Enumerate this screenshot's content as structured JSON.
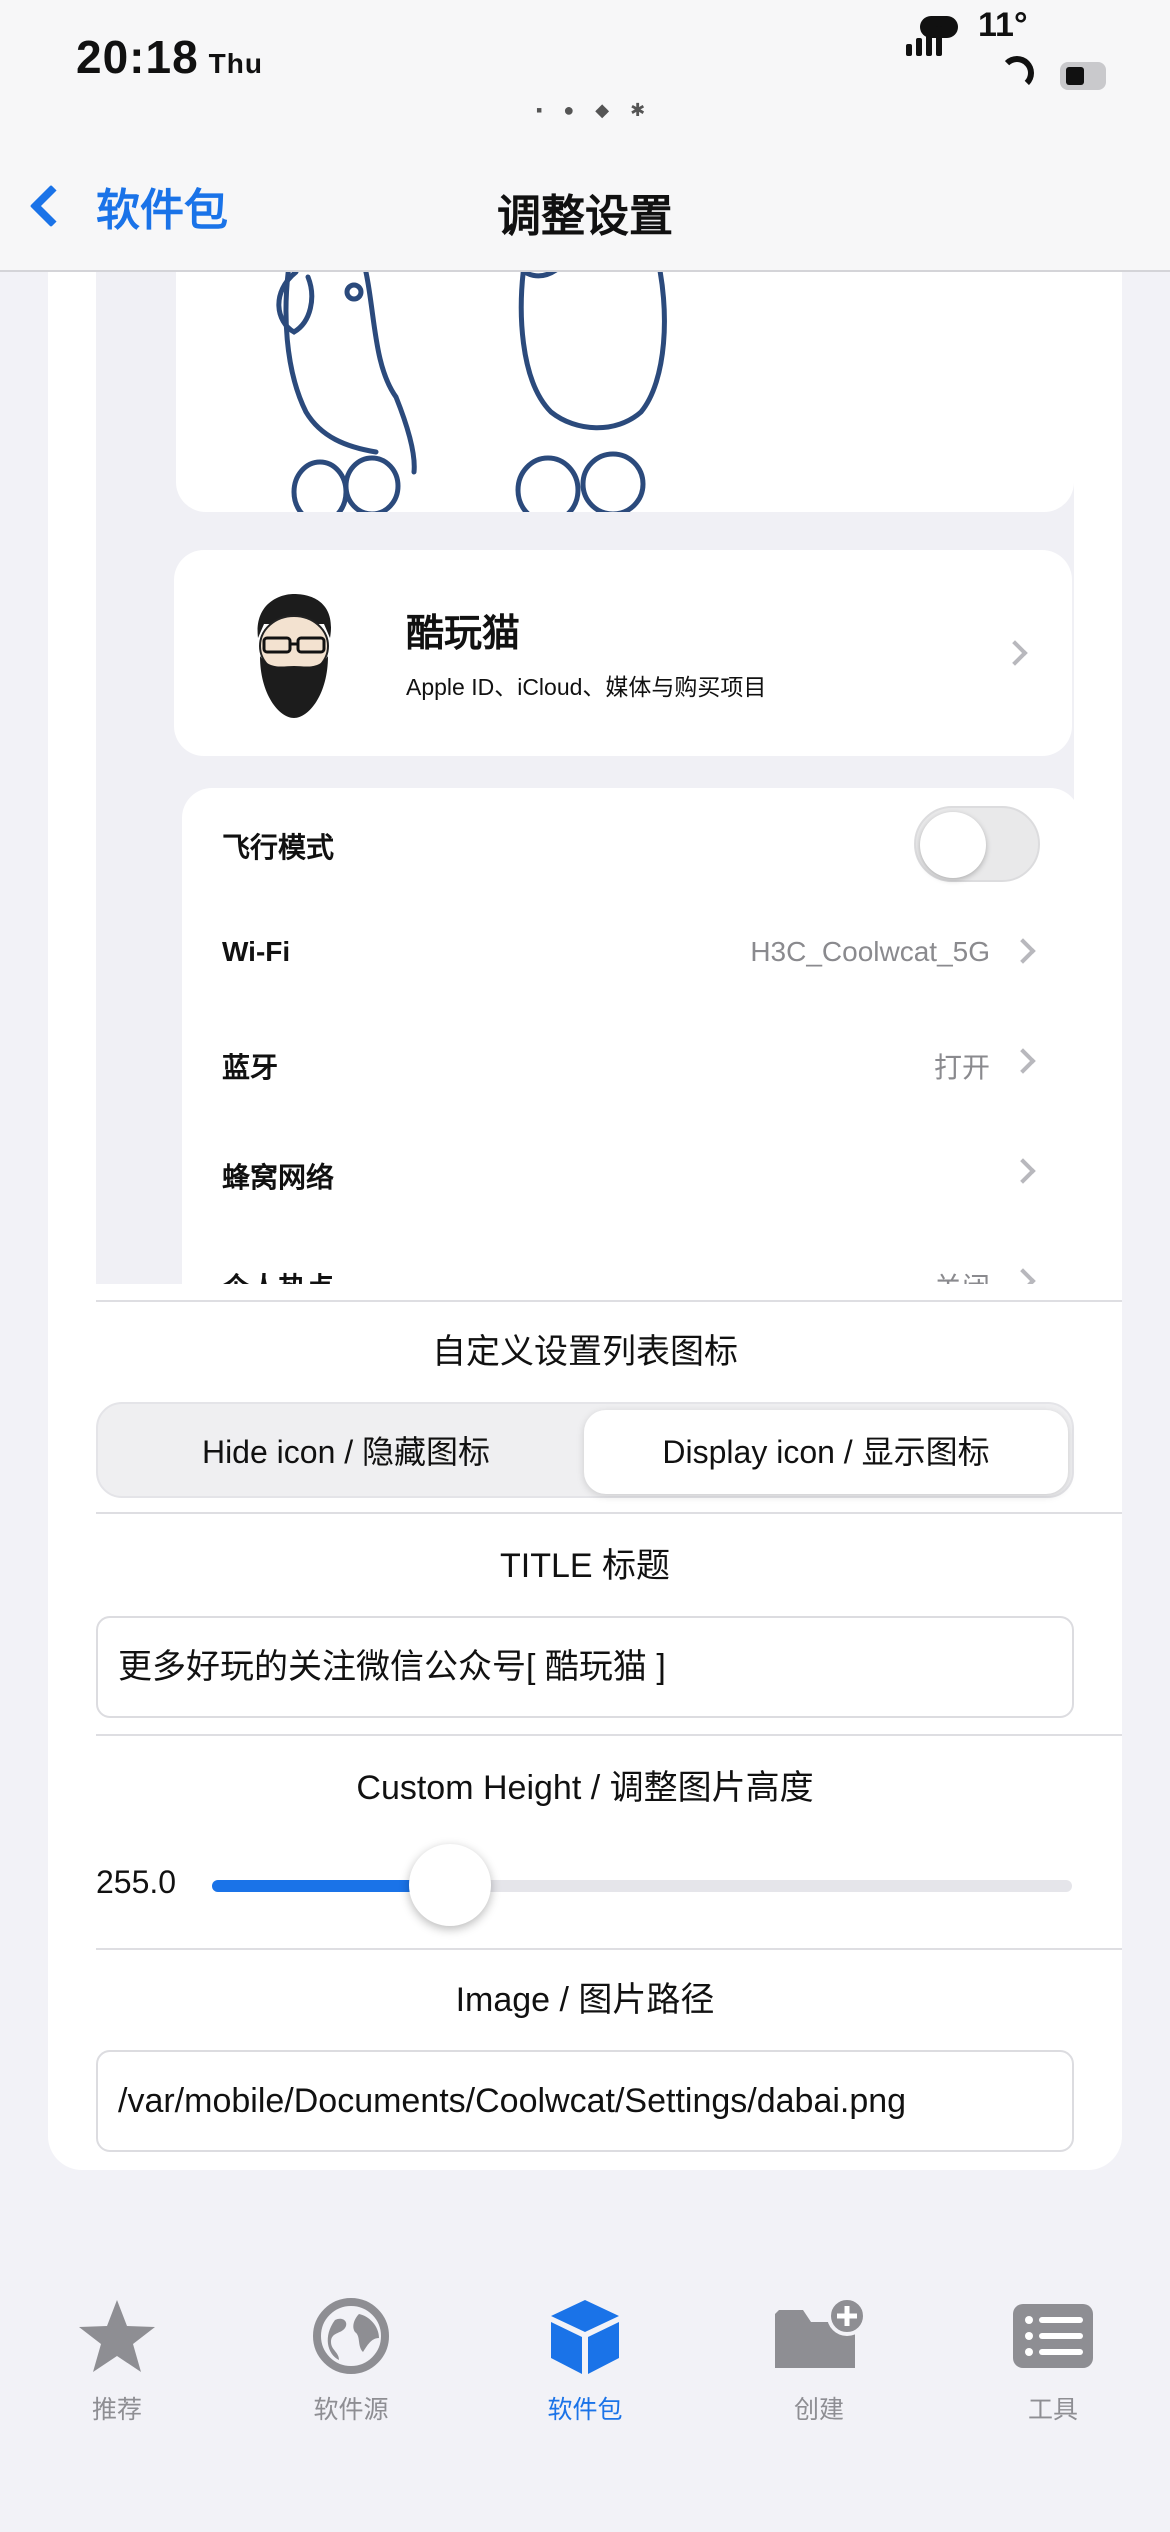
{
  "status_bar": {
    "time": "20:18",
    "day": "Thu",
    "temperature": "11°"
  },
  "nav": {
    "back_label": "软件包",
    "title": "调整设置"
  },
  "preview": {
    "apple_id": {
      "name": "酷玩猫",
      "subtitle": "Apple ID、iCloud、媒体与购买项目"
    },
    "rows": [
      {
        "label": "飞行模式",
        "value": "",
        "type": "toggle",
        "on": false
      },
      {
        "label": "Wi-Fi",
        "value": "H3C_Coolwcat_5G",
        "type": "link"
      },
      {
        "label": "蓝牙",
        "value": "打开",
        "type": "link"
      },
      {
        "label": "蜂窝网络",
        "value": "",
        "type": "link"
      },
      {
        "label": "个人热点",
        "value": "关闭",
        "type": "link"
      }
    ]
  },
  "controls": {
    "icon_section_title": "自定义设置列表图标",
    "segments": [
      {
        "label": "Hide icon / 隐藏图标"
      },
      {
        "label": "Display icon / 显示图标"
      }
    ],
    "selected_segment": "Display icon / 显示图标",
    "title_section": "TITLE 标题",
    "title_value": "更多好玩的关注微信公众号[ 酷玩猫 ]",
    "height_section": "Custom Height / 调整图片高度",
    "height_value": "255.0",
    "height_fraction": 0.277,
    "image_section": "Image / 图片路径",
    "image_path": "/var/mobile/Documents/Coolwcat/Settings/dabai.png"
  },
  "tabbar": {
    "tabs": [
      {
        "label": "推荐",
        "icon": "star-icon"
      },
      {
        "label": "软件源",
        "icon": "globe-icon"
      },
      {
        "label": "软件包",
        "icon": "package-icon"
      },
      {
        "label": "创建",
        "icon": "folder-add-icon"
      },
      {
        "label": "工具",
        "icon": "list-icon"
      }
    ],
    "active": "软件包"
  },
  "colors": {
    "accent": "#1a73e8",
    "inactive": "#8e8e93"
  }
}
